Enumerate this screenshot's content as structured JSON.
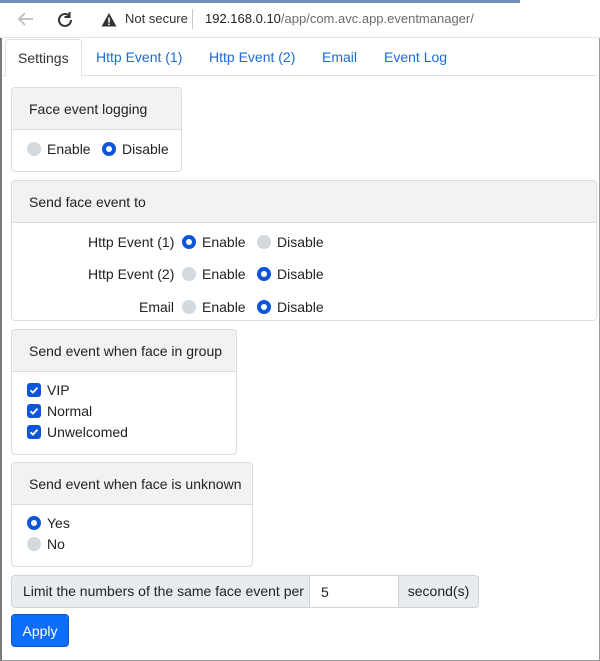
{
  "browser": {
    "security_label": "Not secure",
    "url_host": "192.168.0.10",
    "url_path": "/app/com.avc.app.eventmanager/"
  },
  "tabs": [
    {
      "label": "Settings",
      "active": true
    },
    {
      "label": "Http Event (1)",
      "active": false
    },
    {
      "label": "Http Event (2)",
      "active": false
    },
    {
      "label": "Email",
      "active": false
    },
    {
      "label": "Event Log",
      "active": false
    }
  ],
  "face_logging": {
    "title": "Face event logging",
    "enable_label": "Enable",
    "disable_label": "Disable",
    "value": "Disable"
  },
  "send_to": {
    "title": "Send face event to",
    "rows": [
      {
        "label": "Http Event (1)",
        "enable_label": "Enable",
        "disable_label": "Disable",
        "value": "Enable"
      },
      {
        "label": "Http Event (2)",
        "enable_label": "Enable",
        "disable_label": "Disable",
        "value": "Disable"
      },
      {
        "label": "Email",
        "enable_label": "Enable",
        "disable_label": "Disable",
        "value": "Disable"
      }
    ]
  },
  "group": {
    "title": "Send event when face in group",
    "items": [
      {
        "label": "VIP",
        "checked": true
      },
      {
        "label": "Normal",
        "checked": true
      },
      {
        "label": "Unwelcomed",
        "checked": true
      }
    ]
  },
  "unknown": {
    "title": "Send event when face is unknown",
    "yes_label": "Yes",
    "no_label": "No",
    "value": "Yes"
  },
  "limit": {
    "label": "Limit the numbers of the same face event per",
    "value": "5",
    "suffix": "second(s)"
  },
  "apply_label": "Apply",
  "colors": {
    "accent": "#0d6efd",
    "radio_checked": "#0d55d9",
    "radio_unchecked": "#d4d9de",
    "link": "#1a6cd3"
  }
}
